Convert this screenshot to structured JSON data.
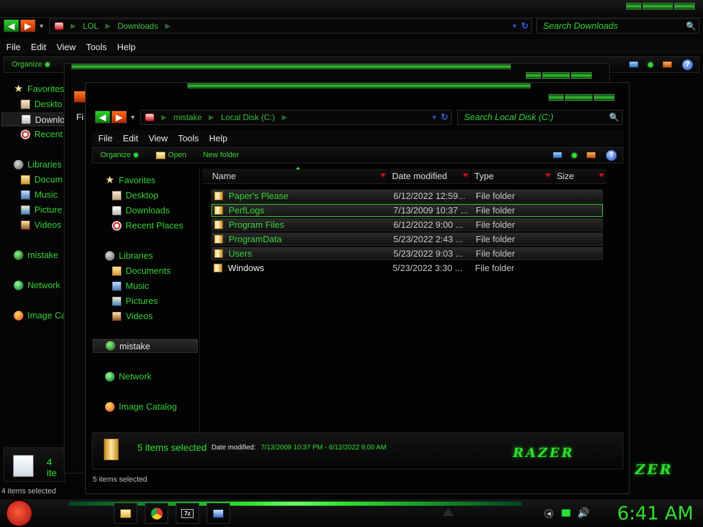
{
  "back_window": {
    "breadcrumb": [
      "LOL",
      "Downloads"
    ],
    "search_placeholder": "Search Downloads",
    "menu": [
      "File",
      "Edit",
      "View",
      "Tools",
      "Help"
    ],
    "organize": "Organize",
    "nav": {
      "favorites": "Favorites",
      "desktop": "Deskto",
      "downloads": "Downlo",
      "recent": "Recent",
      "libraries": "Libraries",
      "documents": "Docum",
      "music": "Music",
      "pictures": "Picture",
      "videos": "Videos",
      "homegroup": "mistake",
      "network": "Network",
      "image_catalog": "Image Ca"
    },
    "details_count": "4 ite",
    "status": "4 items selected"
  },
  "middle_window": {
    "menu_fragment": "Fi"
  },
  "window": {
    "breadcrumb": [
      "mistake",
      "Local Disk (C:)"
    ],
    "search_placeholder": "Search Local Disk (C:)",
    "menu": [
      "File",
      "Edit",
      "View",
      "Tools",
      "Help"
    ],
    "toolbar": {
      "organize": "Organize",
      "open": "Open",
      "new_folder": "New folder"
    },
    "nav": {
      "favorites": "Favorites",
      "desktop": "Desktop",
      "downloads": "Downloads",
      "recent": "Recent Places",
      "libraries": "Libraries",
      "documents": "Documents",
      "music": "Music",
      "pictures": "Pictures",
      "videos": "Videos",
      "homegroup": "mistake",
      "network": "Network",
      "image_catalog": "Image Catalog"
    },
    "columns": {
      "name": "Name",
      "date": "Date modified",
      "type": "Type",
      "size": "Size"
    },
    "files": [
      {
        "name": "Paper's Please",
        "date": "6/12/2022 12:59...",
        "type": "File folder",
        "state": "selected"
      },
      {
        "name": "PerfLogs",
        "date": "7/13/2009 10:37 ...",
        "type": "File folder",
        "state": "focused"
      },
      {
        "name": "Program Files",
        "date": "6/12/2022 9:00 ...",
        "type": "File folder",
        "state": "selected"
      },
      {
        "name": "ProgramData",
        "date": "5/23/2022 2:43 ...",
        "type": "File folder",
        "state": "selected"
      },
      {
        "name": "Users",
        "date": "5/23/2022 9:03 ...",
        "type": "File folder",
        "state": "selected"
      },
      {
        "name": "Windows",
        "date": "5/23/2022 3:30 ...",
        "type": "File folder",
        "state": "normal"
      }
    ],
    "details": {
      "count": "5 items selected",
      "date_label": "Date modified:",
      "date_value": "7/13/2009 10:37 PM - 6/12/2022 9:00 AM",
      "brand": "RAZER"
    },
    "status": "5 items selected"
  },
  "taskbar": {
    "clock": "6:41 AM",
    "brand": "ZER"
  },
  "colors": {
    "accent": "#2ee02e",
    "background": "#000000"
  }
}
